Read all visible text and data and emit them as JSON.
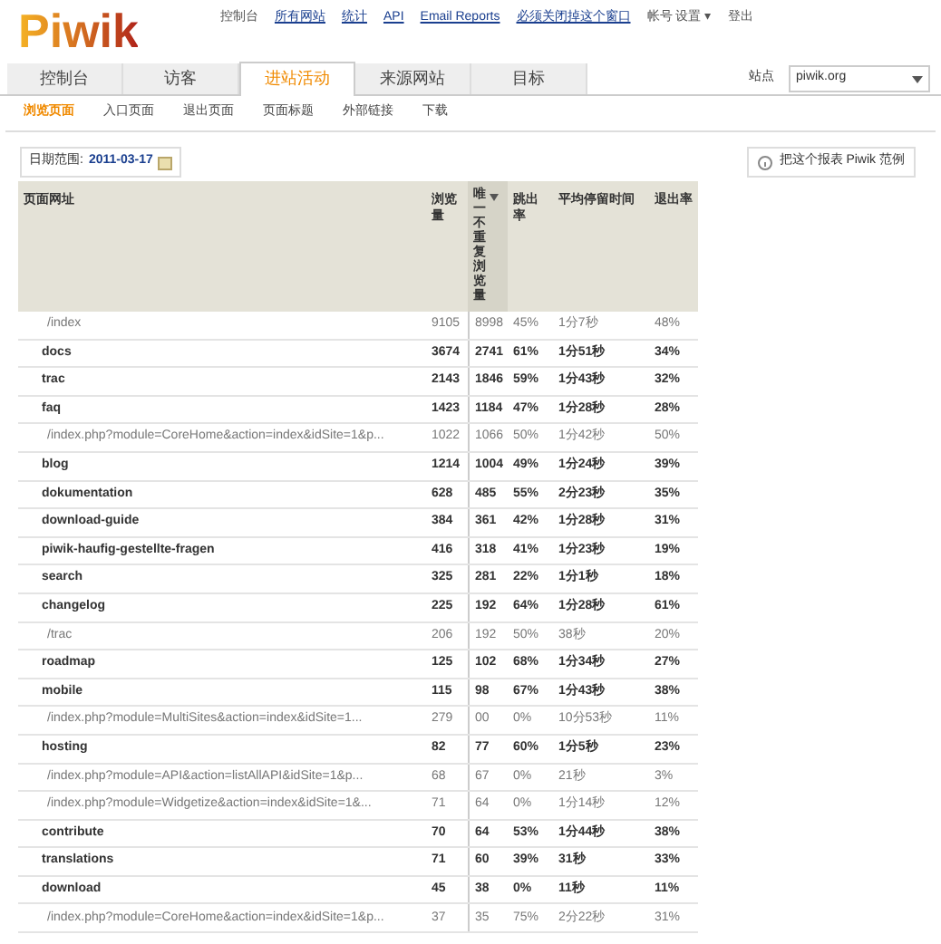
{
  "logo": "Piwik",
  "top_links": [
    {
      "label": "控制台",
      "link": false
    },
    {
      "label": "所有网站",
      "link": true
    },
    {
      "label": "统计",
      "link": true
    },
    {
      "label": "API",
      "link": true
    },
    {
      "label": "Email Reports",
      "link": true
    },
    {
      "label": "必须关闭掉这个窗口",
      "link": true
    },
    {
      "label": "帐号 设置 ▾",
      "link": false
    },
    {
      "label": "登出",
      "link": false
    }
  ],
  "tabs": [
    {
      "label": "控制台",
      "selected": false
    },
    {
      "label": "访客",
      "selected": false
    },
    {
      "label": "进站活动",
      "selected": true
    },
    {
      "label": "来源网站",
      "selected": false
    },
    {
      "label": "目标",
      "selected": false
    }
  ],
  "site_selector": {
    "label": "站点",
    "value": "piwik.org"
  },
  "subtabs": [
    {
      "label": "浏览页面",
      "selected": true
    },
    {
      "label": "入口页面",
      "selected": false
    },
    {
      "label": "退出页面",
      "selected": false
    },
    {
      "label": "页面标题",
      "selected": false
    },
    {
      "label": "外部链接",
      "selected": false
    },
    {
      "label": "下载",
      "selected": false
    }
  ],
  "date": {
    "label": "日期范围:",
    "value": "2011-03-17"
  },
  "help_button": "把这个报表 Piwik 范例",
  "table": {
    "columns": [
      {
        "label": "页面网址",
        "sorted": false
      },
      {
        "label": "浏览量",
        "sorted": false
      },
      {
        "label": "唯一不重复浏览量",
        "sorted": true
      },
      {
        "label": "跳出率",
        "sorted": false
      },
      {
        "label": "平均停留时间",
        "sorted": false
      },
      {
        "label": "退出率",
        "sorted": false
      }
    ],
    "rows": [
      {
        "kind": "page",
        "cells": [
          "/index",
          "9105",
          "8998",
          "45%",
          "1分7秒",
          "48%"
        ]
      },
      {
        "kind": "folder",
        "cells": [
          "docs",
          "3674",
          "2741",
          "61%",
          "1分51秒",
          "34%"
        ]
      },
      {
        "kind": "folder",
        "cells": [
          "trac",
          "2143",
          "1846",
          "59%",
          "1分43秒",
          "32%"
        ]
      },
      {
        "kind": "folder",
        "cells": [
          "faq",
          "1423",
          "1184",
          "47%",
          "1分28秒",
          "28%"
        ]
      },
      {
        "kind": "page",
        "cells": [
          "/index.php?module=CoreHome&action=index&idSite=1&p...",
          "1022",
          "1066",
          "50%",
          "1分42秒",
          "50%"
        ]
      },
      {
        "kind": "folder",
        "cells": [
          "blog",
          "1214",
          "1004",
          "49%",
          "1分24秒",
          "39%"
        ]
      },
      {
        "kind": "folder",
        "cells": [
          "dokumentation",
          "628",
          "485",
          "55%",
          "2分23秒",
          "35%"
        ]
      },
      {
        "kind": "folder",
        "cells": [
          "download-guide",
          "384",
          "361",
          "42%",
          "1分28秒",
          "31%"
        ]
      },
      {
        "kind": "folder",
        "cells": [
          "piwik-haufig-gestellte-fragen",
          "416",
          "318",
          "41%",
          "1分23秒",
          "19%"
        ]
      },
      {
        "kind": "folder",
        "cells": [
          "search",
          "325",
          "281",
          "22%",
          "1分1秒",
          "18%"
        ]
      },
      {
        "kind": "folder",
        "cells": [
          "changelog",
          "225",
          "192",
          "64%",
          "1分28秒",
          "61%"
        ]
      },
      {
        "kind": "page",
        "cells": [
          "/trac",
          "206",
          "192",
          "50%",
          "38秒",
          "20%"
        ]
      },
      {
        "kind": "folder",
        "cells": [
          "roadmap",
          "125",
          "102",
          "68%",
          "1分34秒",
          "27%"
        ]
      },
      {
        "kind": "folder",
        "cells": [
          "mobile",
          "115",
          "98",
          "67%",
          "1分43秒",
          "38%"
        ]
      },
      {
        "kind": "page",
        "cells": [
          "/index.php?module=MultiSites&action=index&idSite=1...",
          "279",
          "00",
          "0%",
          "10分53秒",
          "11%"
        ]
      },
      {
        "kind": "folder",
        "cells": [
          "hosting",
          "82",
          "77",
          "60%",
          "1分5秒",
          "23%"
        ]
      },
      {
        "kind": "page",
        "cells": [
          "/index.php?module=API&action=listAllAPI&idSite=1&p...",
          "68",
          "67",
          "0%",
          "21秒",
          "3%"
        ]
      },
      {
        "kind": "page",
        "cells": [
          "/index.php?module=Widgetize&action=index&idSite=1&...",
          "71",
          "64",
          "0%",
          "1分14秒",
          "12%"
        ]
      },
      {
        "kind": "folder",
        "cells": [
          "contribute",
          "70",
          "64",
          "53%",
          "1分44秒",
          "38%"
        ]
      },
      {
        "kind": "folder",
        "cells": [
          "translations",
          "71",
          "60",
          "39%",
          "31秒",
          "33%"
        ]
      },
      {
        "kind": "folder",
        "cells": [
          "download",
          "45",
          "38",
          "0%",
          "11秒",
          "11%"
        ]
      },
      {
        "kind": "page",
        "cells": [
          "/index.php?module=CoreHome&action=index&idSite=1&p...",
          "37",
          "35",
          "75%",
          "2分22秒",
          "31%"
        ]
      }
    ]
  }
}
